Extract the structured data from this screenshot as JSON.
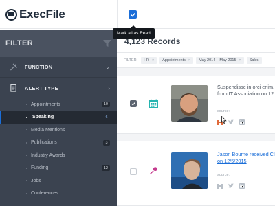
{
  "app": {
    "name": "ExecFile"
  },
  "header": {
    "tooltip": "Mark all as Read"
  },
  "sidebar": {
    "title": "FILTER",
    "function_label": "FUNCTION",
    "alert_type_label": "ALERT TYPE",
    "items": [
      {
        "label": "Appointments",
        "count": "10",
        "active": false
      },
      {
        "label": "Speaking",
        "count": "6",
        "active": true
      },
      {
        "label": "Media Mentions",
        "count": "",
        "active": false
      },
      {
        "label": "Publications",
        "count": "3",
        "active": false
      },
      {
        "label": "Industry Awards",
        "count": "",
        "active": false
      },
      {
        "label": "Funding",
        "count": "12",
        "active": false
      },
      {
        "label": "Jobs",
        "count": "",
        "active": false
      },
      {
        "label": "Conferences",
        "count": "",
        "active": false
      }
    ]
  },
  "main": {
    "records_title": "4,123 Records",
    "filter_label": "FILTER:",
    "chips": [
      "HR",
      "Appointments",
      "May 2014 – May 2015",
      "Sales"
    ],
    "chip_remove": "×",
    "source_label": "source:",
    "cards": [
      {
        "checked": true,
        "line1": "Suspendisse in orci enim.",
        "line2": "from IT Association on 12",
        "type_icon": "calendar-icon"
      },
      {
        "checked": false,
        "line1": "Jason Bourne received CI",
        "line2": "on 12/5/2015",
        "type_icon": "microphone-icon"
      }
    ]
  },
  "colors": {
    "accent": "#1b6ed8",
    "sidebar_bg": "#3b4350",
    "card_icon_teal": "#27b4b0",
    "card_icon_pink": "#c53b8e"
  }
}
